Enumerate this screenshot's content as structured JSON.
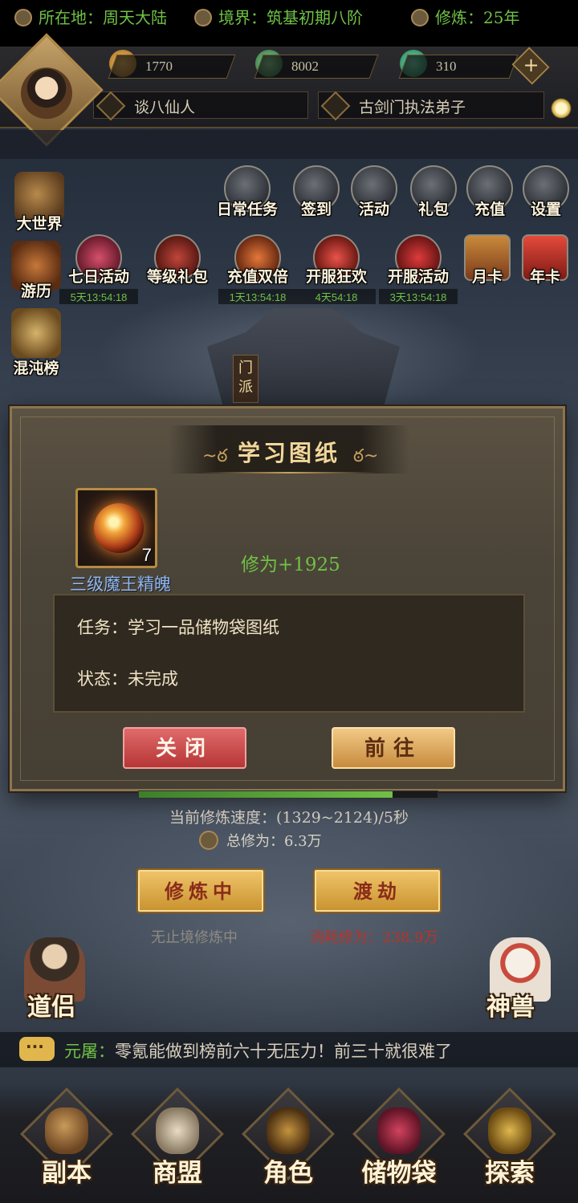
{
  "resources": {
    "gold": "1770",
    "jade": "8002",
    "cloud": "310"
  },
  "player": {
    "title": "谈八仙人",
    "role": "古剑门执法弟子"
  },
  "info": {
    "location": "所在地：周天大陆",
    "realm": "境界：筑基初期八阶",
    "cultivation": "修炼：25年"
  },
  "top_icons": [
    {
      "label": "日常任务"
    },
    {
      "label": "签到"
    },
    {
      "label": "活动"
    },
    {
      "label": "礼包"
    },
    {
      "label": "充值"
    },
    {
      "label": "设置"
    }
  ],
  "event_icons": [
    {
      "label": "七日活动",
      "timer": "5天13:54:18"
    },
    {
      "label": "等级礼包",
      "timer": ""
    },
    {
      "label": "充值双倍",
      "timer": "1天13:54:18"
    },
    {
      "label": "开服狂欢",
      "timer": "4天54:18"
    },
    {
      "label": "开服活动",
      "timer": "3天13:54:18"
    },
    {
      "label": "月卡",
      "timer": ""
    },
    {
      "label": "年卡",
      "timer": ""
    }
  ],
  "left_icons": [
    {
      "label": "大世界"
    },
    {
      "label": "游历"
    },
    {
      "label": "混沌榜"
    }
  ],
  "sect_banner": "门派",
  "dialog": {
    "title": "学习图纸",
    "item_name": "三级魔王精魄",
    "item_count": "7",
    "reward": "修为+1925",
    "task": "任务：学习一品储物袋图纸",
    "status": "状态：未完成",
    "close_label": "关闭",
    "go_label": "前往"
  },
  "cultivation": {
    "progress": 0.85,
    "speed": "当前修炼速度：(1329~2124)/5秒",
    "total": "总修为：6.3万",
    "train_button": "修炼中",
    "tribulation_button": "渡劫",
    "train_status": "无止境修炼中",
    "tribulation_cost": "消耗修为：238.9万"
  },
  "side": {
    "left": "道侣",
    "right": "神兽"
  },
  "chat": {
    "name": "元屠：",
    "message": "零氪能做到榜前六十无压力！前三十就很难了"
  },
  "bottom_nav": [
    {
      "label": "副本"
    },
    {
      "label": "商盟"
    },
    {
      "label": "角色"
    },
    {
      "label": "储物袋"
    },
    {
      "label": "探索"
    }
  ],
  "colors": {
    "accent_green": "#6fc145",
    "gold": "#f2d79b",
    "item_name_blue": "#8fb7f0"
  }
}
